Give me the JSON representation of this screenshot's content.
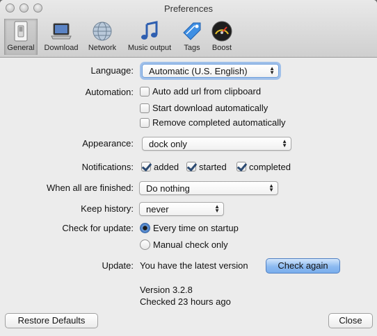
{
  "window": {
    "title": "Preferences"
  },
  "toolbar": {
    "items": [
      {
        "label": "General",
        "icon": "general-switch-icon",
        "selected": true
      },
      {
        "label": "Download",
        "icon": "laptop-icon"
      },
      {
        "label": "Network",
        "icon": "globe-icon"
      },
      {
        "label": "Music output",
        "icon": "music-note-icon"
      },
      {
        "label": "Tags",
        "icon": "tag-icon"
      },
      {
        "label": "Boost",
        "icon": "speedometer-icon"
      }
    ]
  },
  "general": {
    "language_label": "Language:",
    "language_value": "Automatic (U.S. English)",
    "automation_label": "Automation:",
    "automation_options": [
      {
        "label": "Auto add url from clipboard",
        "checked": false
      },
      {
        "label": "Start download automatically",
        "checked": false
      },
      {
        "label": "Remove completed automatically",
        "checked": false
      }
    ],
    "appearance_label": "Appearance:",
    "appearance_value": "dock only",
    "notifications_label": "Notifications:",
    "notifications_options": [
      {
        "label": "added",
        "checked": true
      },
      {
        "label": "started",
        "checked": true
      },
      {
        "label": "completed",
        "checked": true
      }
    ],
    "finished_label": "When all are finished:",
    "finished_value": "Do nothing",
    "history_label": "Keep history:",
    "history_value": "never",
    "update_check_label": "Check for update:",
    "update_options": [
      {
        "label": "Every time on startup",
        "selected": true
      },
      {
        "label": "Manual check only",
        "selected": false
      }
    ],
    "update_label": "Update:",
    "update_status": "You have the latest version",
    "check_again_label": "Check again",
    "version_text": "Version 3.2.8",
    "checked_text": "Checked 23 hours ago"
  },
  "footer": {
    "restore_label": "Restore Defaults",
    "close_label": "Close"
  },
  "colors": {
    "window_bg": "#ececec",
    "accent": "#7aaeec",
    "checkbox_mark": "#2b4a72"
  }
}
